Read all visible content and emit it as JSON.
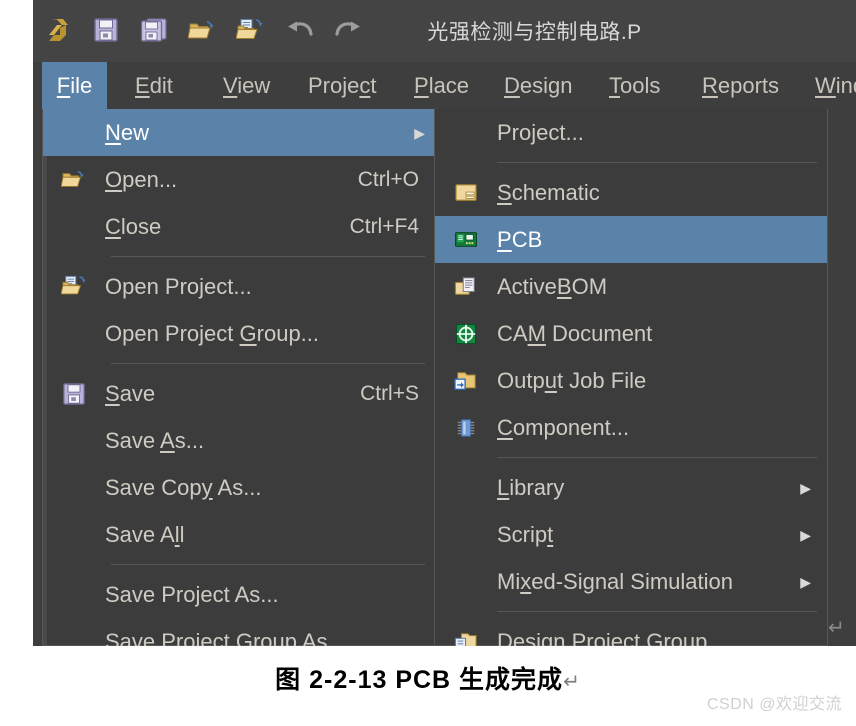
{
  "window": {
    "document_title": "光强检测与控制电路.P",
    "toolbar": {
      "icons": [
        {
          "name": "altium-logo-icon",
          "label": "Altium"
        },
        {
          "name": "save-icon",
          "label": "Save"
        },
        {
          "name": "save-all-icon",
          "label": "Save All"
        },
        {
          "name": "open-folder-icon",
          "label": "Open"
        },
        {
          "name": "open-project-icon",
          "label": "Open Project"
        },
        {
          "name": "undo-icon",
          "label": "Undo"
        },
        {
          "name": "redo-icon",
          "label": "Redo"
        }
      ]
    },
    "menubar": {
      "items": [
        {
          "label": "File",
          "mnemonic": "F",
          "active": true
        },
        {
          "label": "Edit",
          "mnemonic": "E",
          "active": false
        },
        {
          "label": "View",
          "mnemonic": "V",
          "active": false
        },
        {
          "label": "Project",
          "mnemonic": "c",
          "active": false
        },
        {
          "label": "Place",
          "mnemonic": "P",
          "active": false
        },
        {
          "label": "Design",
          "mnemonic": "D",
          "active": false
        },
        {
          "label": "Tools",
          "mnemonic": "T",
          "active": false
        },
        {
          "label": "Reports",
          "mnemonic": "R",
          "active": false
        },
        {
          "label": "Wind",
          "mnemonic": "W",
          "active": false
        }
      ]
    }
  },
  "file_menu": {
    "items": [
      {
        "type": "item",
        "label": "New",
        "pre": "",
        "mn": "N",
        "post": "ew",
        "accel": "",
        "icon": "",
        "submenu": true,
        "selected": true
      },
      {
        "type": "item",
        "label": "Open...",
        "pre": "",
        "mn": "O",
        "post": "pen...",
        "accel": "Ctrl+O",
        "icon": "open-folder-icon",
        "submenu": false,
        "selected": false
      },
      {
        "type": "item",
        "label": "Close",
        "pre": "",
        "mn": "C",
        "post": "lose",
        "accel": "Ctrl+F4",
        "icon": "",
        "submenu": false,
        "selected": false
      },
      {
        "type": "sep"
      },
      {
        "type": "item",
        "label": "Open Project...",
        "pre": "Open Project...",
        "mn": "",
        "post": "",
        "accel": "",
        "icon": "open-project-icon",
        "submenu": false,
        "selected": false
      },
      {
        "type": "item",
        "label": "Open Project Group...",
        "pre": "Open Project ",
        "mn": "G",
        "post": "roup...",
        "accel": "",
        "icon": "",
        "submenu": false,
        "selected": false
      },
      {
        "type": "sep"
      },
      {
        "type": "item",
        "label": "Save",
        "pre": "",
        "mn": "S",
        "post": "ave",
        "accel": "Ctrl+S",
        "icon": "save-icon",
        "submenu": false,
        "selected": false
      },
      {
        "type": "item",
        "label": "Save As...",
        "pre": "Save ",
        "mn": "A",
        "post": "s...",
        "accel": "",
        "icon": "",
        "submenu": false,
        "selected": false
      },
      {
        "type": "item",
        "label": "Save Copy As...",
        "pre": "Save Cop",
        "mn": "y",
        "post": " As...",
        "accel": "",
        "icon": "",
        "submenu": false,
        "selected": false
      },
      {
        "type": "item",
        "label": "Save All",
        "pre": "Save A",
        "mn": "l",
        "post": "l",
        "accel": "",
        "icon": "",
        "submenu": false,
        "selected": false
      },
      {
        "type": "sep"
      },
      {
        "type": "item",
        "label": "Save Project As...",
        "pre": "Save Project As...",
        "mn": "",
        "post": "",
        "accel": "",
        "icon": "",
        "submenu": false,
        "selected": false
      },
      {
        "type": "item",
        "label": "Save Project Group As...",
        "pre": "Save Project Group As...",
        "mn": "",
        "post": "",
        "accel": "",
        "icon": "",
        "submenu": false,
        "selected": false
      }
    ]
  },
  "new_submenu": {
    "items": [
      {
        "type": "item",
        "label": "Project...",
        "pre": "Project...",
        "mn": "",
        "post": "",
        "icon": "",
        "submenu": false,
        "selected": false
      },
      {
        "type": "sep"
      },
      {
        "type": "item",
        "label": "Schematic",
        "pre": "",
        "mn": "S",
        "post": "chematic",
        "icon": "schematic-icon",
        "submenu": false,
        "selected": false
      },
      {
        "type": "item",
        "label": "PCB",
        "pre": "",
        "mn": "P",
        "post": "CB",
        "icon": "pcb-icon",
        "submenu": false,
        "selected": true
      },
      {
        "type": "item",
        "label": "ActiveBOM",
        "pre": "Active",
        "mn": "B",
        "post": "OM",
        "icon": "activebom-icon",
        "submenu": false,
        "selected": false
      },
      {
        "type": "item",
        "label": "CAM Document",
        "pre": "CA",
        "mn": "M",
        "post": " Document",
        "icon": "cam-document-icon",
        "submenu": false,
        "selected": false
      },
      {
        "type": "item",
        "label": "Output Job File",
        "pre": "Outp",
        "mn": "u",
        "post": "t Job File",
        "icon": "output-job-icon",
        "submenu": false,
        "selected": false
      },
      {
        "type": "item",
        "label": "Component...",
        "pre": "",
        "mn": "C",
        "post": "omponent...",
        "icon": "component-icon",
        "submenu": false,
        "selected": false
      },
      {
        "type": "sep"
      },
      {
        "type": "item",
        "label": "Library",
        "pre": "",
        "mn": "L",
        "post": "ibrary",
        "icon": "",
        "submenu": true,
        "selected": false
      },
      {
        "type": "item",
        "label": "Script",
        "pre": "Scrip",
        "mn": "t",
        "post": "",
        "icon": "",
        "submenu": true,
        "selected": false
      },
      {
        "type": "item",
        "label": "Mixed-Signal Simulation",
        "pre": "Mi",
        "mn": "x",
        "post": "ed-Signal Simulation",
        "icon": "",
        "submenu": true,
        "selected": false
      },
      {
        "type": "sep"
      },
      {
        "type": "item",
        "label": "Design Project Group",
        "pre": "Design Project ",
        "mn": "G",
        "post": "roup",
        "icon": "design-project-group-icon",
        "submenu": false,
        "selected": false
      }
    ]
  },
  "figure": {
    "caption": "图 2-2-13  PCB 生成完成",
    "pilcrow": "↵",
    "paragraph_mark": "↵"
  },
  "watermark": {
    "text": "CSDN @欢迎交流"
  },
  "colors": {
    "window_bg": "#3e3e3e",
    "toolbar_bg": "#444444",
    "menu_bg": "#3c3c3c",
    "menu_text": "#cfcbc3",
    "highlight": "#5b82a8",
    "separator": "#575757",
    "page_bg": "#ffffff"
  }
}
